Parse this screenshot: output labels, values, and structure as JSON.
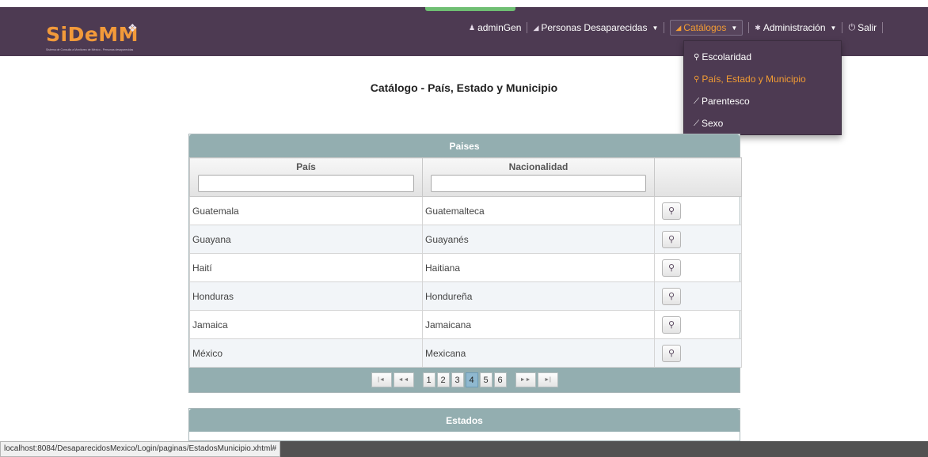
{
  "app": {
    "logo_text": "SiDeMM",
    "logo_subtitle": "Sistema de Consulta a Monitoreo de México - Personas desaparecidas"
  },
  "nav": {
    "user": "adminGen",
    "personas": "Personas Desaparecidas",
    "catalogos": "Catálogos",
    "administracion": "Administración",
    "salir": "Salir"
  },
  "catalog_menu": [
    {
      "label": "Escolaridad",
      "icon": "search-icon"
    },
    {
      "label": "País, Estado y Municipio",
      "icon": "search-icon",
      "current": true
    },
    {
      "label": "Parentesco",
      "icon": "wrench-icon"
    },
    {
      "label": "Sexo",
      "icon": "wrench-icon"
    }
  ],
  "page": {
    "title": "Catálogo - País, Estado y Municipio"
  },
  "paises": {
    "header": "Paises",
    "col_pais": "País",
    "col_nacionalidad": "Nacionalidad",
    "filter_pais": "",
    "filter_nacionalidad": "",
    "rows": [
      {
        "pais": "Guatemala",
        "nacionalidad": "Guatemalteca"
      },
      {
        "pais": "Guayana",
        "nacionalidad": "Guayanés"
      },
      {
        "pais": "Haití",
        "nacionalidad": "Haitiana"
      },
      {
        "pais": "Honduras",
        "nacionalidad": "Hondureña"
      },
      {
        "pais": "Jamaica",
        "nacionalidad": "Jamaicana"
      },
      {
        "pais": "México",
        "nacionalidad": "Mexicana"
      }
    ],
    "paginator": {
      "first": "|◄",
      "prev": "◄◄",
      "next": "►►",
      "last": "►|",
      "pages": [
        "1",
        "2",
        "3",
        "4",
        "5",
        "6"
      ],
      "current_page": "4"
    }
  },
  "estados": {
    "header": "Estados"
  },
  "status": {
    "url": "localhost:8084/DesaparecidosMexico/Login/paginas/EstadosMunicipio.xhtml#"
  },
  "colors": {
    "navbar": "#4d3a52",
    "accent": "#f39c33",
    "panel_header": "#93aeb0"
  }
}
